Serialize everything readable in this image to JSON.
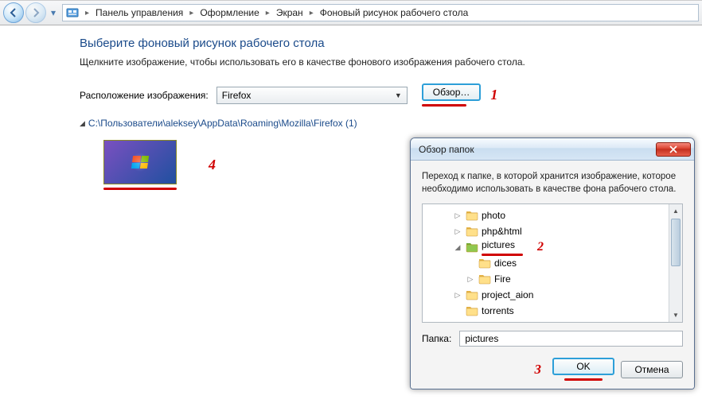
{
  "breadcrumbs": {
    "items": [
      "Панель управления",
      "Оформление",
      "Экран",
      "Фоновый рисунок рабочего стола"
    ]
  },
  "page": {
    "heading": "Выберите фоновый рисунок рабочего стола",
    "subtext": "Щелкните изображение, чтобы использовать его в качестве фонового изображения рабочего стола.",
    "location_label": "Расположение изображения:",
    "location_value": "Firefox",
    "browse_label": "Обзор…",
    "path_text": "C:\\Пользователи\\aleksey\\AppData\\Roaming\\Mozilla\\Firefox (1)"
  },
  "annotations": {
    "a1": "1",
    "a2": "2",
    "a3": "3",
    "a4": "4"
  },
  "dialog": {
    "title": "Обзор папок",
    "message": "Переход к папке, в которой хранится изображение, которое необходимо использовать в качестве фона рабочего стола.",
    "tree": [
      {
        "indent": 2,
        "exp": "▷",
        "name": "photo",
        "sel": false
      },
      {
        "indent": 2,
        "exp": "▷",
        "name": "php&html",
        "sel": false
      },
      {
        "indent": 2,
        "exp": "◢",
        "name": "pictures",
        "sel": true
      },
      {
        "indent": 3,
        "exp": "",
        "name": "dices",
        "sel": false
      },
      {
        "indent": 3,
        "exp": "▷",
        "name": "Fire",
        "sel": false
      },
      {
        "indent": 2,
        "exp": "▷",
        "name": "project_aion",
        "sel": false
      },
      {
        "indent": 2,
        "exp": "",
        "name": "torrents",
        "sel": false
      }
    ],
    "folder_label": "Папка:",
    "folder_value": "pictures",
    "ok": "OK",
    "cancel": "Отмена"
  }
}
